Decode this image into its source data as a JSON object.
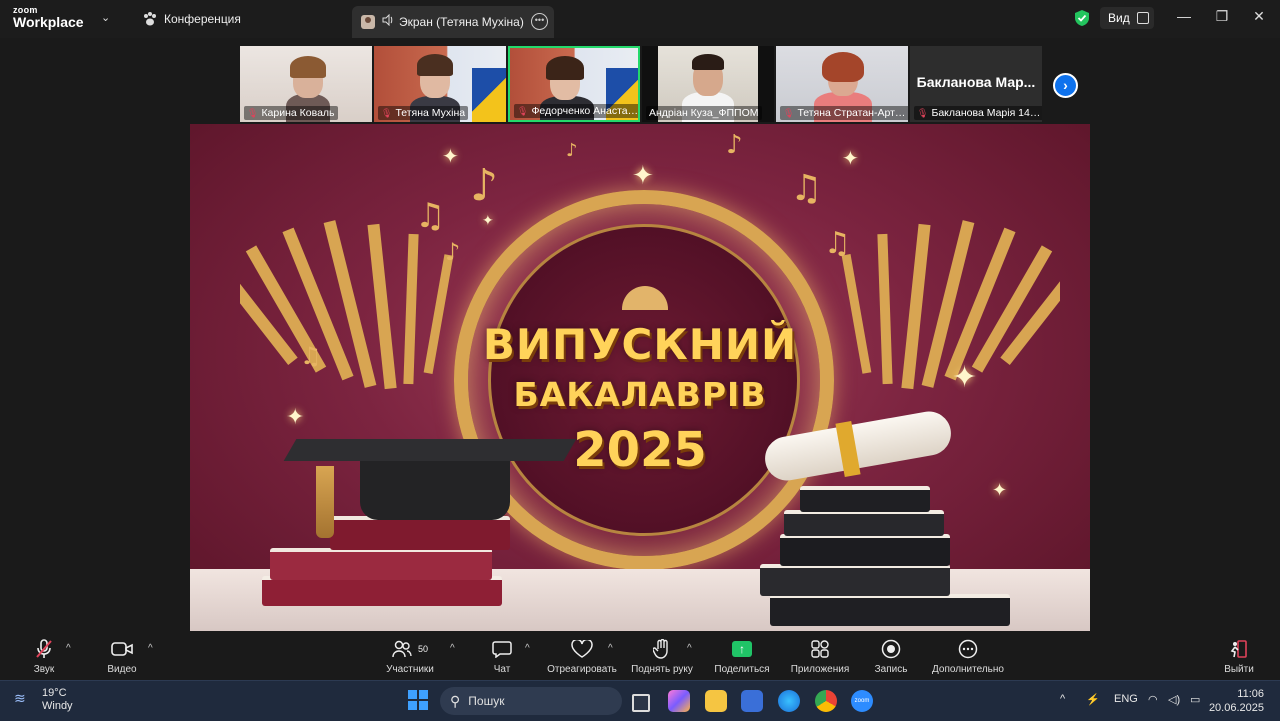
{
  "titlebar": {
    "logo_top": "zoom",
    "logo_bottom": "Workplace",
    "tab_meeting": "Конференция",
    "tab_screen": "Экран (Тетяна Мухіна)",
    "view_label": "Вид"
  },
  "participants": [
    {
      "name": "Карина Коваль",
      "muted": true
    },
    {
      "name": "Тетяна Мухіна",
      "muted": true
    },
    {
      "name": "Федорченко Анастасія_Ф...",
      "muted": true,
      "active": true
    },
    {
      "name": "Андріан Куза_ФППОМ",
      "muted": false
    },
    {
      "name": "Тетяна Стратан-Арти...",
      "muted": true
    },
    {
      "name": "Бакланова Марія 14М...",
      "muted": true,
      "display_name": "Бакланова Мар..."
    }
  ],
  "shared_screen": {
    "line1": "ВИПУСКНИЙ",
    "line2": "БАКАЛАВРІВ",
    "line3": "2025"
  },
  "toolbar": {
    "audio": "Звук",
    "video": "Видео",
    "participants": "Участники",
    "participants_count": "50",
    "chat": "Чат",
    "react": "Отреагировать",
    "raise_hand": "Поднять руку",
    "share": "Поделиться",
    "apps": "Приложения",
    "record": "Запись",
    "more": "Дополнительно",
    "leave": "Выйти"
  },
  "taskbar": {
    "temp": "19°C",
    "weather": "Windy",
    "search_placeholder": "Пошук",
    "lang": "ENG",
    "time": "11:06",
    "date": "20.06.2025"
  },
  "colors": {
    "active_border": "#23d96b",
    "share_green": "#20c467",
    "leave_red": "#e0435a",
    "next_blue": "#0e72ed",
    "title_gold": "#ffd35a"
  }
}
